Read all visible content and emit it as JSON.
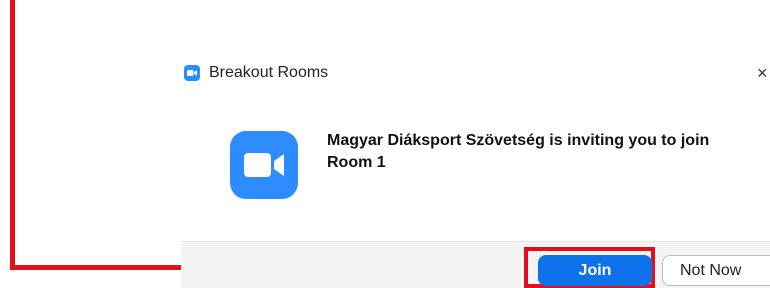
{
  "dialog": {
    "title": "Breakout Rooms",
    "close_glyph": "×",
    "title_icon": "zoom-camera-icon",
    "logo_icon": "zoom-camera-icon",
    "message": "Magyar Diáksport Szövetség is inviting you to join Room 1"
  },
  "buttons": {
    "join_label": "Join",
    "not_now_label": "Not Now"
  },
  "colors": {
    "zoom_blue": "#2d8cff",
    "join_blue": "#0e72ed",
    "annotation_red": "#e3101b"
  }
}
